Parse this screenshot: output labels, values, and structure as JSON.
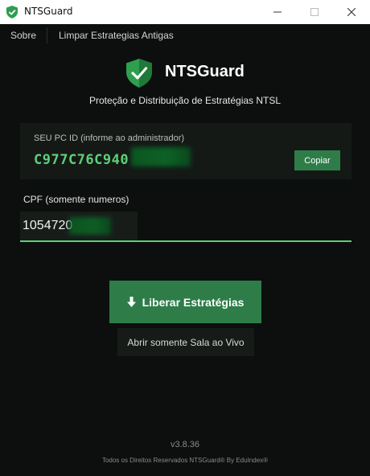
{
  "window": {
    "title": "NTSGuard",
    "minimize_icon": "minimize-icon",
    "maximize_icon": "maximize-icon",
    "close_icon": "close-icon"
  },
  "menu": {
    "about": "Sobre",
    "clear": "Limpar Estrategias Antigas"
  },
  "header": {
    "logo_icon": "shield-check-icon",
    "brand": "NTSGuard",
    "subtitle": "Proteção e Distribuição de Estratégias NTSL"
  },
  "pc_id": {
    "label": "SEU PC ID  (informe ao administrador)",
    "value": "C977C76C940",
    "copy_label": "Copiar"
  },
  "cpf": {
    "label": "CPF (somente numeros)",
    "value": "1054720"
  },
  "actions": {
    "primary_label": "Liberar Estratégias",
    "primary_icon": "download-arrow-icon",
    "secondary_label": "Abrir somente Sala ao Vivo"
  },
  "footer": {
    "version": "v3.8.36",
    "copyright": "Todos os Direitos Reservados NTSGuard® By EduIndex®"
  },
  "colors": {
    "accent": "#2e7d49",
    "accent_text": "#5fcf78",
    "background": "#0c0f0d"
  }
}
